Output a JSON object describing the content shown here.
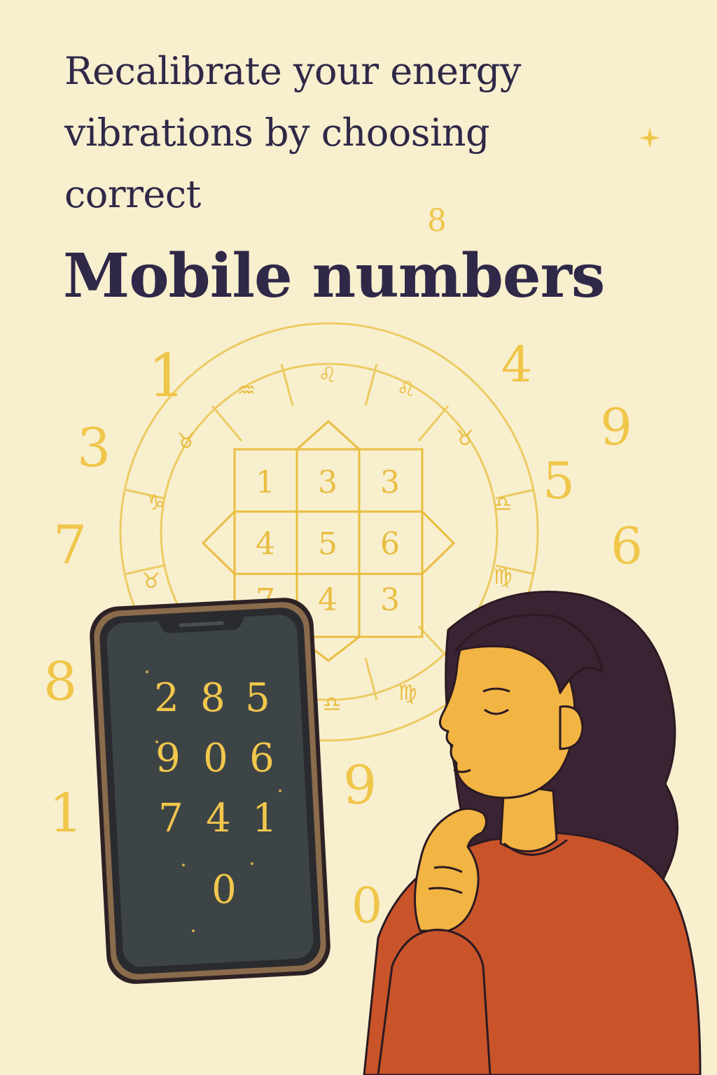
{
  "headline": {
    "line1": "Recalibrate your energy",
    "line2": "vibrations by choosing",
    "line3": "correct",
    "emphasis": "Mobile numbers"
  },
  "floating_numbers": [
    "8",
    "1",
    "4",
    "3",
    "9",
    "5",
    "7",
    "6",
    "8",
    "9",
    "1",
    "0"
  ],
  "grid_cells": [
    "1",
    "3",
    "3",
    "4",
    "5",
    "6",
    "7",
    "4",
    "3"
  ],
  "zodiac_signs": [
    "♒",
    "♌",
    "♌",
    "♉",
    "♉",
    "♑",
    "♎",
    "♉",
    "♍",
    "♎",
    "♍"
  ],
  "phone_digits": [
    "2",
    "8",
    "5",
    "9",
    "0",
    "6",
    "7",
    "4",
    "1",
    "0"
  ],
  "colors": {
    "background": "#f8efcf",
    "ink": "#2f2847",
    "gold": "#f0c64a",
    "phone_screen": "#3d4446",
    "sweater": "#c9542a",
    "skin": "#f2b443",
    "hair": "#3a2433"
  }
}
